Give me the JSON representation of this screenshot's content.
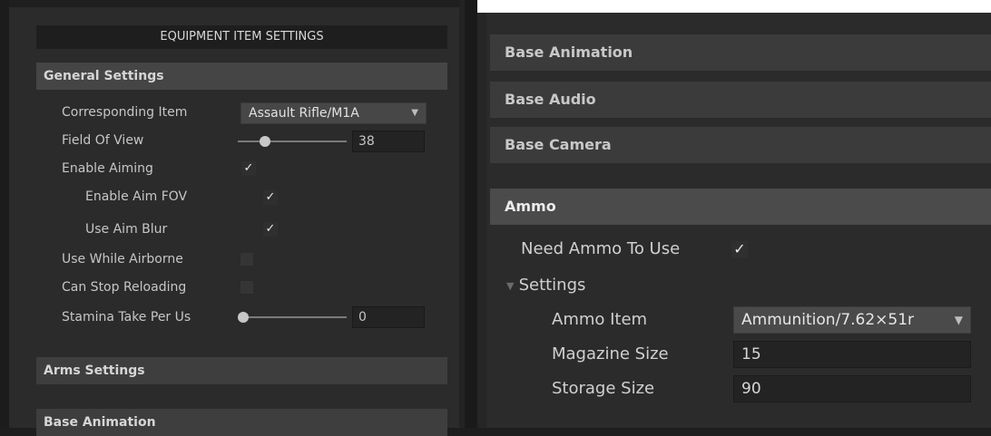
{
  "left": {
    "header": "EQUIPMENT ITEM SETTINGS",
    "general": {
      "title": "General Settings",
      "corresponding_item_label": "Corresponding Item",
      "corresponding_item_value": "Assault Rifle/M1A",
      "fov_label": "Field Of View",
      "fov_value": "38",
      "fov_fraction": 0.22,
      "enable_aiming_label": "Enable Aiming",
      "enable_aiming": true,
      "enable_aim_fov_label": "Enable Aim FOV",
      "enable_aim_fov": true,
      "use_aim_blur_label": "Use Aim Blur",
      "use_aim_blur": true,
      "use_while_airborne_label": "Use While Airborne",
      "use_while_airborne": false,
      "can_stop_reloading_label": "Can Stop Reloading",
      "can_stop_reloading": false,
      "stamina_label": "Stamina Take Per Us",
      "stamina_value": "0",
      "stamina_fraction": 0.0
    },
    "arms_settings": "Arms Settings",
    "base_animation": "Base Animation"
  },
  "right": {
    "base_animation": "Base Animation",
    "base_audio": "Base Audio",
    "base_camera": "Base Camera",
    "ammo": {
      "title": "Ammo",
      "need_ammo_label": "Need Ammo To Use",
      "need_ammo": true,
      "settings_label": "Settings",
      "ammo_item_label": "Ammo Item",
      "ammo_item_value": "Ammunition/7.62×51r",
      "magazine_size_label": "Magazine Size",
      "magazine_size_value": "15",
      "storage_size_label": "Storage Size",
      "storage_size_value": "90"
    }
  },
  "icons": {
    "check": "✓",
    "dropdown_caret": "▼",
    "foldout": "▼"
  }
}
